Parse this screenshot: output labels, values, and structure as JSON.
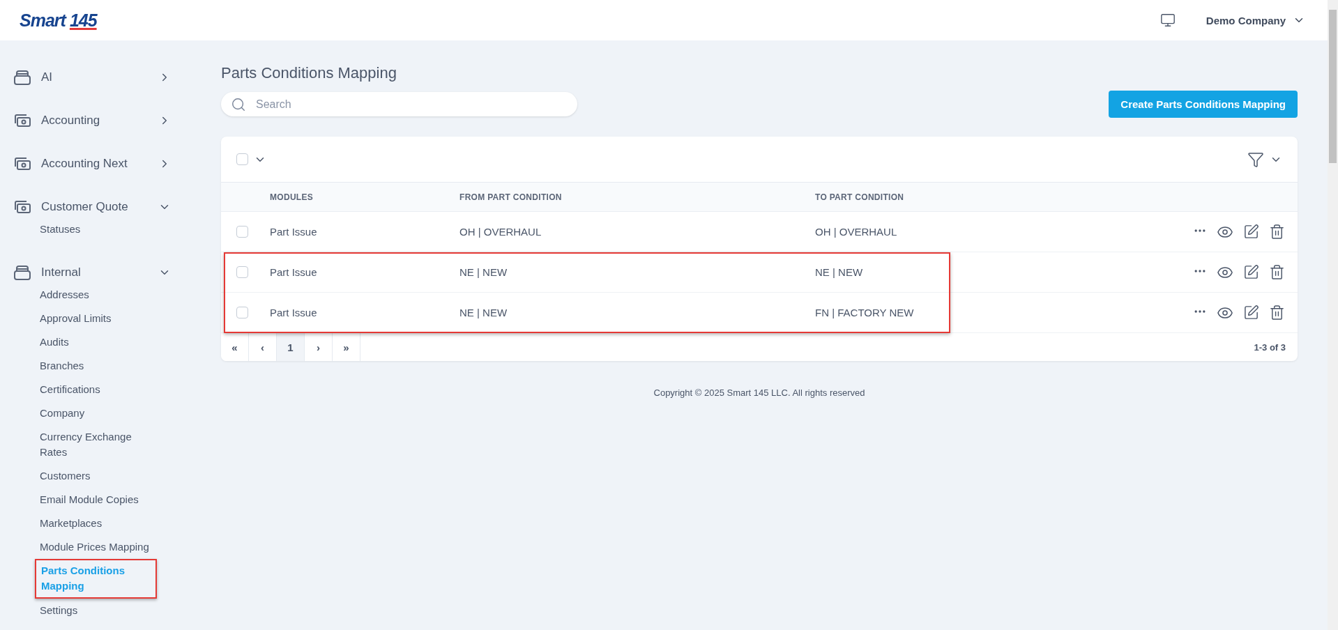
{
  "header": {
    "logo": {
      "word": "Smart",
      "number": "145"
    },
    "company": "Demo Company"
  },
  "sidebar": {
    "sections": [
      {
        "label": "AI",
        "kind": "tray",
        "expanded": false
      },
      {
        "label": "Accounting",
        "kind": "cash",
        "expanded": false
      },
      {
        "label": "Accounting Next",
        "kind": "cash",
        "expanded": false
      },
      {
        "label": "Customer Quote",
        "kind": "cash",
        "expanded": true,
        "children": [
          {
            "label": "Statuses",
            "selected": false,
            "highlighted": false
          }
        ]
      },
      {
        "label": "Internal",
        "kind": "tray",
        "expanded": true,
        "children": [
          {
            "label": "Addresses",
            "selected": false,
            "highlighted": false
          },
          {
            "label": "Approval Limits",
            "selected": false,
            "highlighted": false
          },
          {
            "label": "Audits",
            "selected": false,
            "highlighted": false
          },
          {
            "label": "Branches",
            "selected": false,
            "highlighted": false
          },
          {
            "label": "Certifications",
            "selected": false,
            "highlighted": false
          },
          {
            "label": "Company",
            "selected": false,
            "highlighted": false
          },
          {
            "label": "Currency Exchange Rates",
            "selected": false,
            "highlighted": false
          },
          {
            "label": "Customers",
            "selected": false,
            "highlighted": false
          },
          {
            "label": "Email Module Copies",
            "selected": false,
            "highlighted": false
          },
          {
            "label": "Marketplaces",
            "selected": false,
            "highlighted": false
          },
          {
            "label": "Module Prices Mapping",
            "selected": false,
            "highlighted": false
          },
          {
            "label": "Parts Conditions Mapping",
            "selected": true,
            "highlighted": true
          },
          {
            "label": "Settings",
            "selected": false,
            "highlighted": false
          }
        ]
      }
    ]
  },
  "page": {
    "title": "Parts Conditions Mapping",
    "search": {
      "placeholder": "Search"
    },
    "create_button": "Create Parts Conditions Mapping"
  },
  "table": {
    "select_all": {
      "checked": false
    },
    "columns": [
      "MODULES",
      "FROM PART CONDITION",
      "TO PART CONDITION"
    ],
    "rows": [
      {
        "checked": false,
        "highlighted": false,
        "cells": [
          "Part Issue",
          "OH | OVERHAUL",
          "OH | OVERHAUL"
        ]
      },
      {
        "checked": false,
        "highlighted": true,
        "cells": [
          "Part Issue",
          "NE | NEW",
          "NE | NEW"
        ]
      },
      {
        "checked": false,
        "highlighted": true,
        "cells": [
          "Part Issue",
          "NE | NEW",
          "FN | FACTORY NEW"
        ]
      }
    ],
    "pagination": {
      "buttons": [
        {
          "label": "«",
          "selected": false
        },
        {
          "label": "‹",
          "selected": false
        },
        {
          "label": "1",
          "selected": true
        },
        {
          "label": "›",
          "selected": false
        },
        {
          "label": "»",
          "selected": false
        }
      ],
      "summary": "1-3 of 3"
    }
  },
  "footer": "Copyright © 2025 Smart 145 LLC. All rights reserved"
}
